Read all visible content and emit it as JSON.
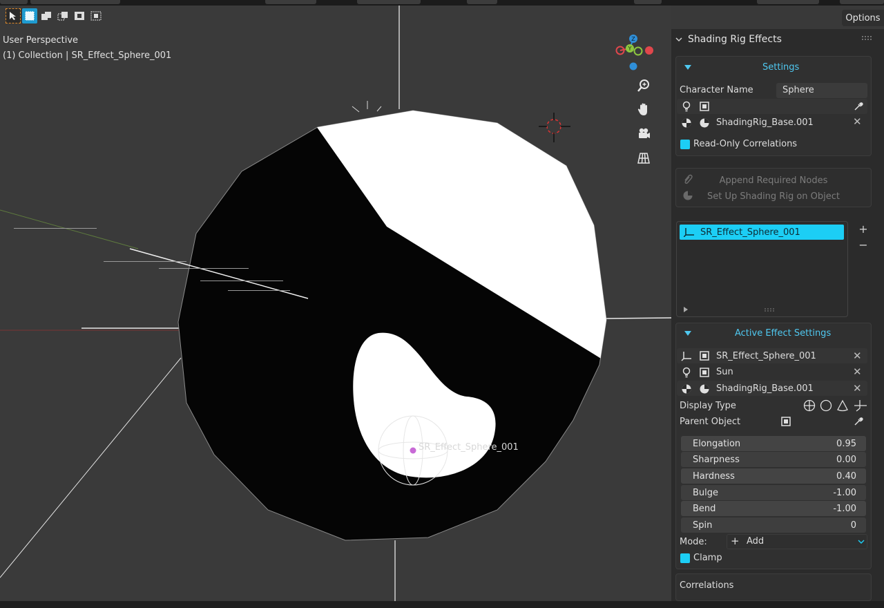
{
  "viewport": {
    "view_label": "User Perspective",
    "collection_label": "(1) Collection | SR_Effect_Sphere_001",
    "object_label": "SR_Effect_Sphere_001",
    "gizmo_axes": {
      "z": "Z",
      "y": "Y"
    }
  },
  "header": {
    "options_label": "Options"
  },
  "sidebar": {
    "panel_title": "Shading Rig Effects",
    "settings": {
      "title": "Settings",
      "character_name_label": "Character Name",
      "character_name_value": "Sphere",
      "base_material": "ShadingRig_Base.001",
      "read_only_label": "Read-Only Correlations",
      "read_only_checked": true
    },
    "actions": {
      "append_label": "Append Required Nodes",
      "setup_label": "Set Up Shading Rig on Object"
    },
    "effect_list": {
      "items": [
        "SR_Effect_Sphere_001"
      ],
      "add_symbol": "+",
      "remove_symbol": "−"
    },
    "active_effect": {
      "title": "Active Effect Settings",
      "effect_object": "SR_Effect_Sphere_001",
      "light": "Sun",
      "material": "ShadingRig_Base.001",
      "display_type_label": "Display Type",
      "parent_object_label": "Parent Object",
      "params": [
        {
          "label": "Elongation",
          "value": "0.95"
        },
        {
          "label": "Sharpness",
          "value": "0.00"
        },
        {
          "label": "Hardness",
          "value": "0.40"
        },
        {
          "label": "Bulge",
          "value": "-1.00"
        },
        {
          "label": "Bend",
          "value": "-1.00"
        },
        {
          "label": "Spin",
          "value": "0"
        }
      ],
      "mode_label": "Mode:",
      "mode_value": "Add",
      "clamp_label": "Clamp",
      "clamp_checked": true
    },
    "correlations_title": "Correlations"
  },
  "colors": {
    "accent": "#1ccef5",
    "viewport_bg": "#3a3a3a",
    "panel_bg": "#2b2b2b",
    "axis_x": "#e0474c",
    "axis_y": "#8dc63f",
    "axis_z": "#2f8fd8"
  }
}
